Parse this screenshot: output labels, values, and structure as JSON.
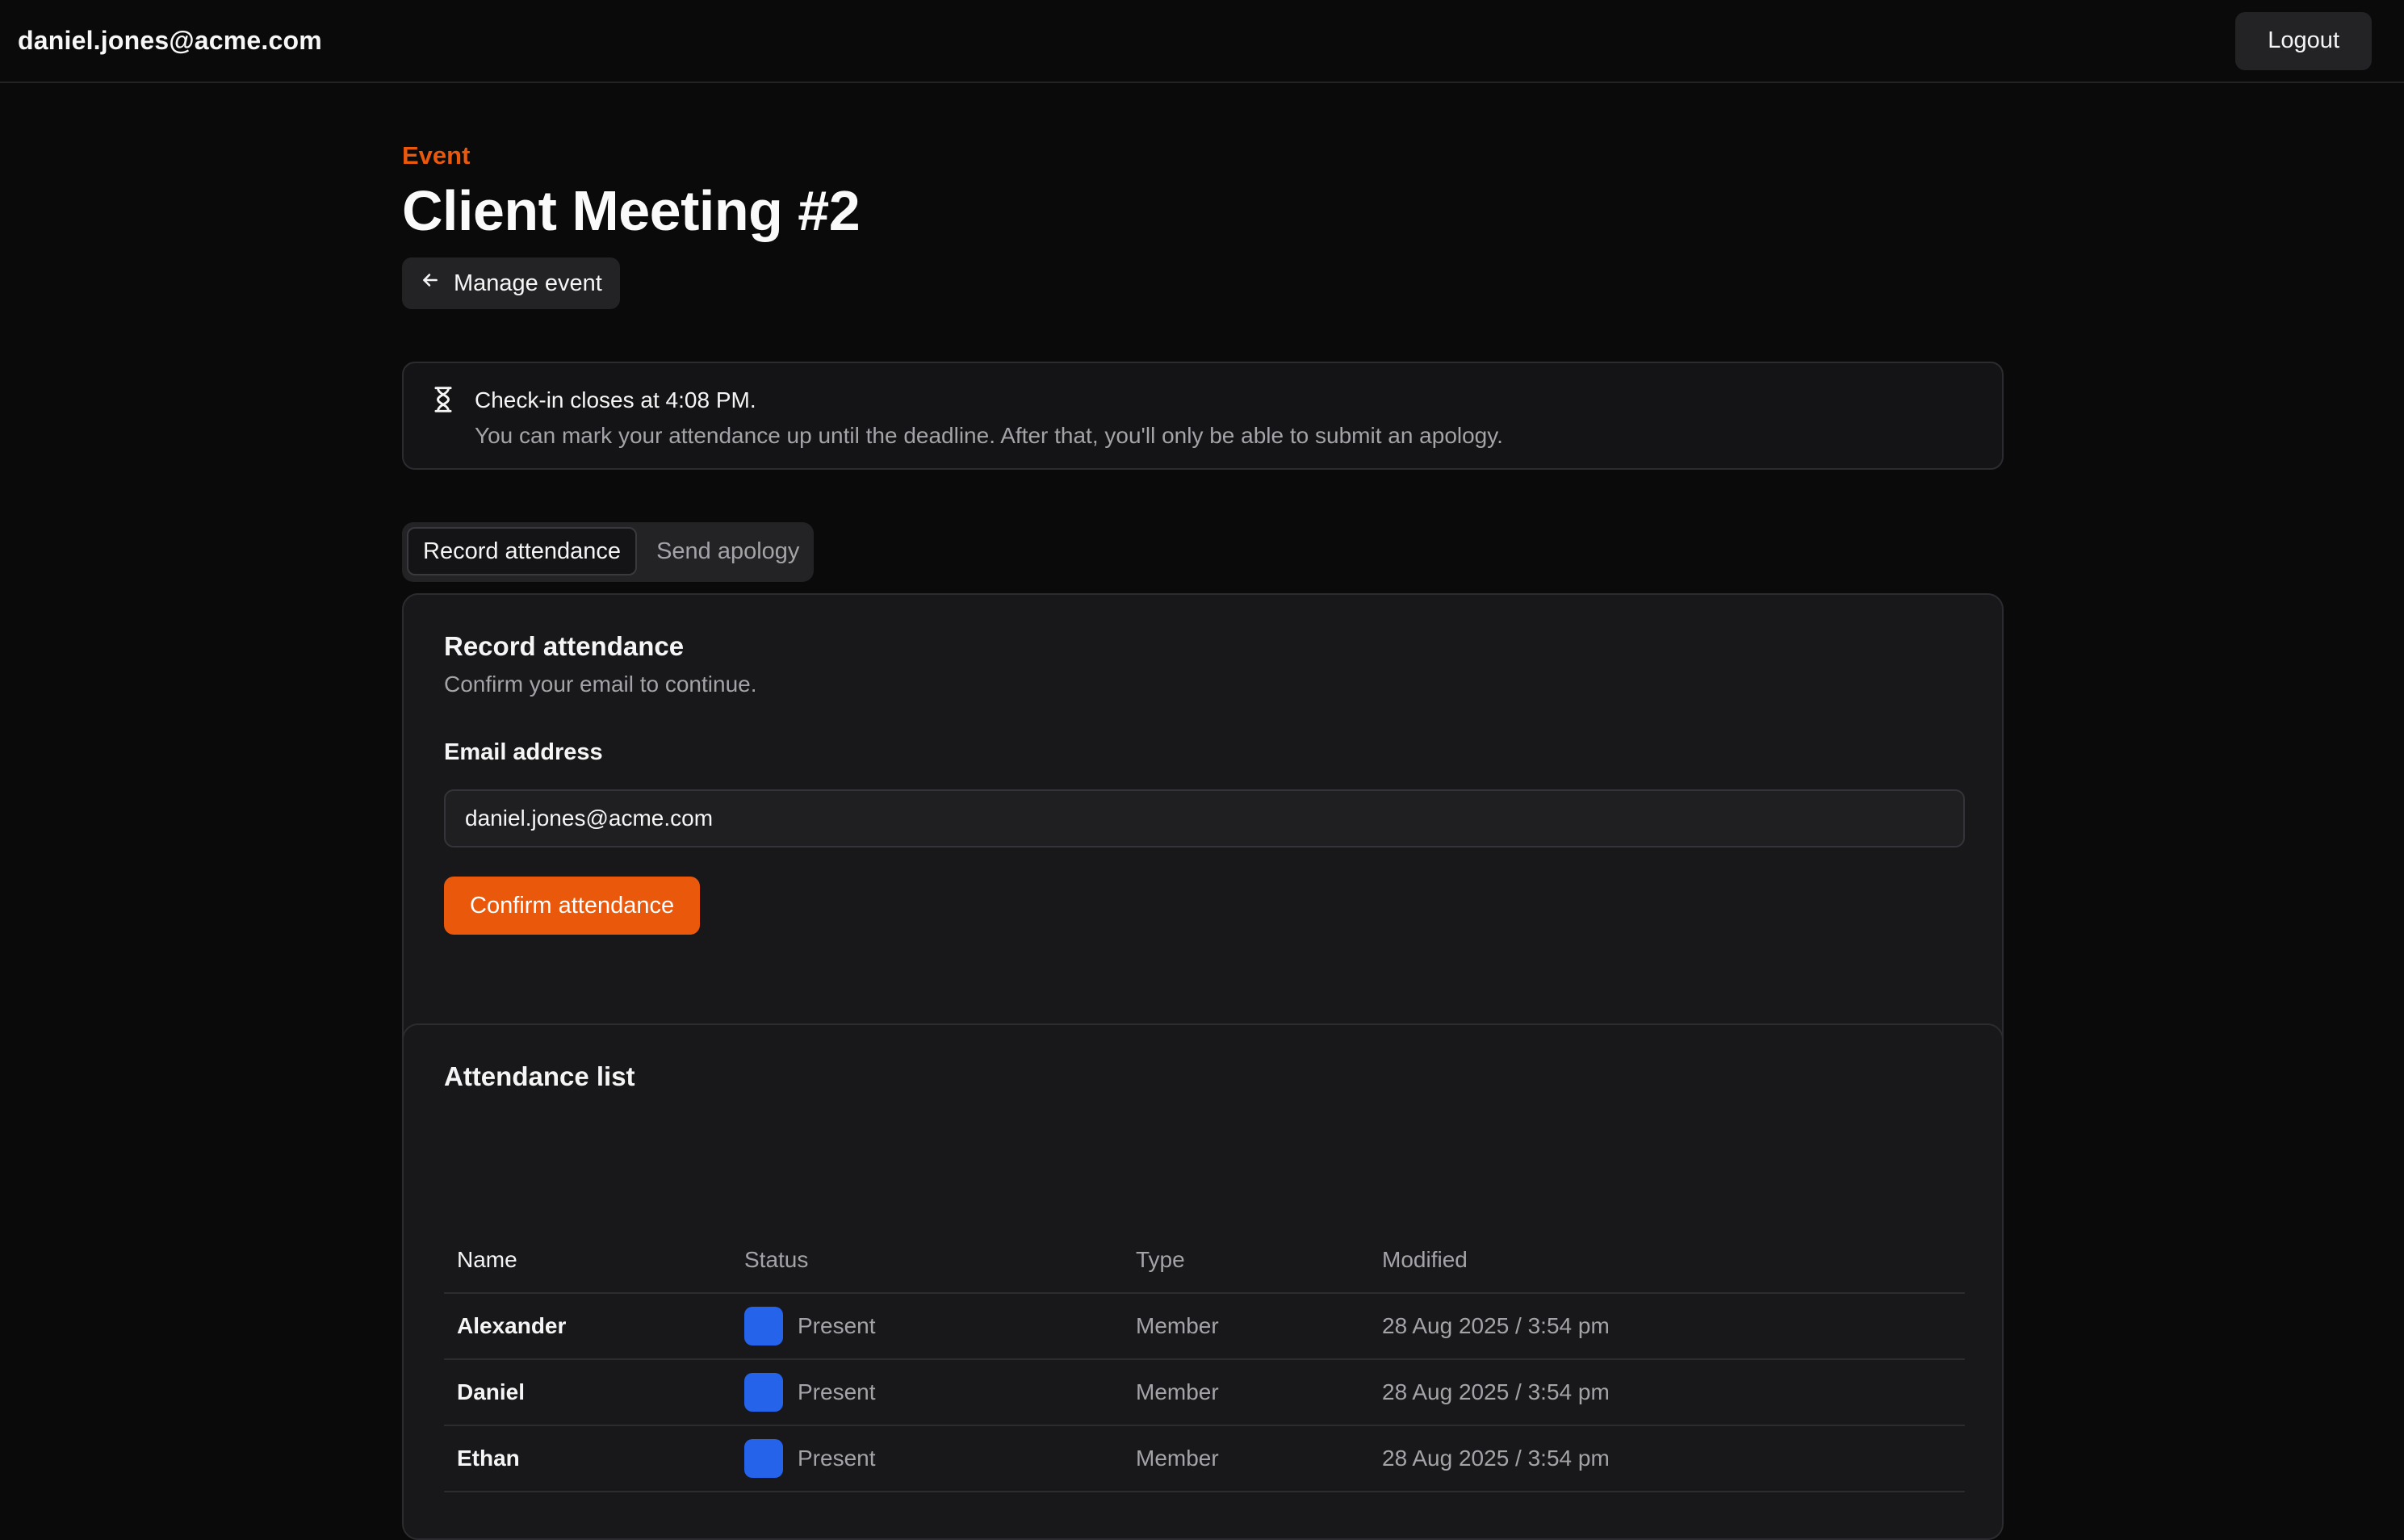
{
  "header": {
    "user_email": "daniel.jones@acme.com",
    "logout_label": "Logout"
  },
  "page": {
    "eyebrow": "Event",
    "title": "Client Meeting #2",
    "manage_label": "Manage event",
    "manage_icon": "arrow-left-icon"
  },
  "notice": {
    "icon": "hourglass-icon",
    "title": "Check-in closes at 4:08 PM.",
    "body": "You can mark your attendance up until the deadline. After that, you'll only be able to submit an apology."
  },
  "tabs": [
    {
      "label": "Record attendance",
      "active": true
    },
    {
      "label": "Send apology",
      "active": false
    }
  ],
  "record": {
    "title": "Record attendance",
    "subtitle": "Confirm your email to continue.",
    "email_label": "Email address",
    "email_value": "daniel.jones@acme.com",
    "confirm_label": "Confirm attendance"
  },
  "attendance": {
    "title": "Attendance list",
    "columns": [
      "Name",
      "Status",
      "Type",
      "Modified"
    ],
    "rows": [
      {
        "name": "Alexander",
        "status": "Present",
        "type": "Member",
        "modified": "28 Aug 2025 / 3:54 pm"
      },
      {
        "name": "Daniel",
        "status": "Present",
        "type": "Member",
        "modified": "28 Aug 2025 / 3:54 pm"
      },
      {
        "name": "Ethan",
        "status": "Present",
        "type": "Member",
        "modified": "28 Aug 2025 / 3:54 pm"
      }
    ]
  },
  "colors": {
    "accent": "#ea580c",
    "status_present": "#2563eb",
    "background": "#0a0a0b"
  }
}
